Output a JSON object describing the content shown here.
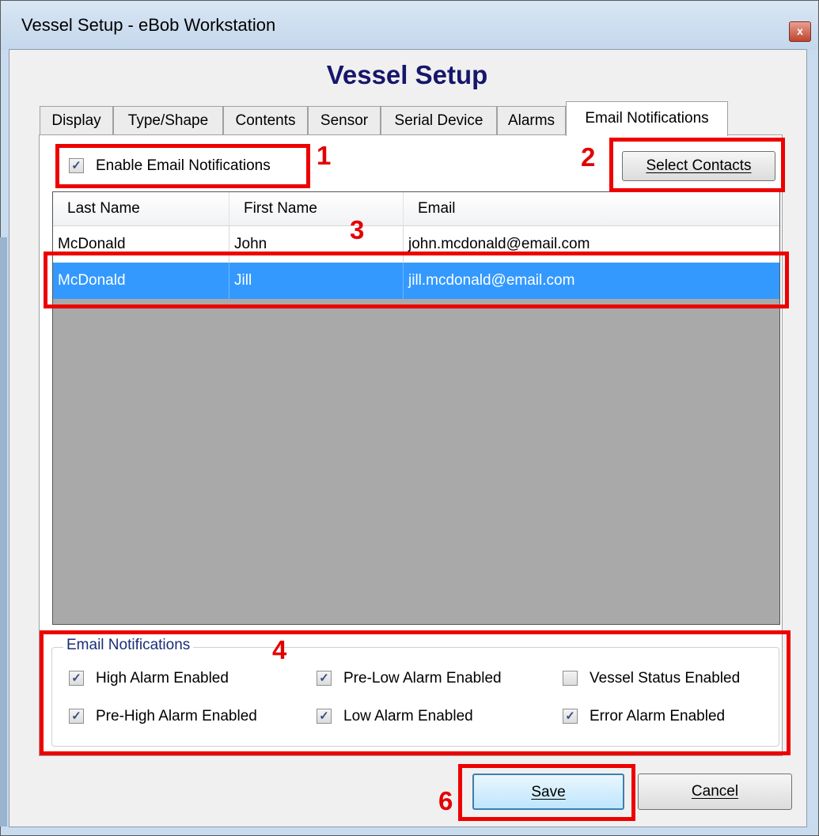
{
  "window": {
    "title": "Vessel Setup - eBob Workstation",
    "close_glyph": "x"
  },
  "header": {
    "title": "Vessel Setup"
  },
  "tabs": [
    {
      "label": "Display"
    },
    {
      "label": "Type/Shape"
    },
    {
      "label": "Contents"
    },
    {
      "label": "Sensor"
    },
    {
      "label": "Serial Device"
    },
    {
      "label": "Alarms"
    },
    {
      "label": "Email Notifications",
      "active": true
    }
  ],
  "email_tab": {
    "enable_label": "Enable Email Notifications",
    "enable_checked": true,
    "select_contacts_label": "Select Contacts",
    "grid": {
      "columns": [
        "Last Name",
        "First Name",
        "Email"
      ],
      "rows": [
        {
          "last": "McDonald",
          "first": "John",
          "email": "john.mcdonald@email.com",
          "selected": false
        },
        {
          "last": "McDonald",
          "first": "Jill",
          "email": "jill.mcdonald@email.com",
          "selected": true
        }
      ]
    },
    "notifications": {
      "legend": "Email Notifications",
      "items": [
        {
          "label": "High Alarm Enabled",
          "checked": true
        },
        {
          "label": "Pre-Low Alarm Enabled",
          "checked": true
        },
        {
          "label": "Vessel Status Enabled",
          "checked": false
        },
        {
          "label": "Pre-High Alarm Enabled",
          "checked": true
        },
        {
          "label": "Low Alarm Enabled",
          "checked": true
        },
        {
          "label": "Error Alarm Enabled",
          "checked": true
        }
      ]
    }
  },
  "buttons": {
    "save_label": "Save",
    "cancel_label": "Cancel"
  },
  "callouts": {
    "c1": "1",
    "c2": "2",
    "c3": "3",
    "c4": "4",
    "c6": "6"
  },
  "colors": {
    "selection": "#3399ff",
    "callout_red": "#ee0000",
    "title_blue": "#16166c",
    "grid_background": "#a9a9a9"
  },
  "icons": {
    "checkmark": "check-icon",
    "close": "close-icon"
  }
}
